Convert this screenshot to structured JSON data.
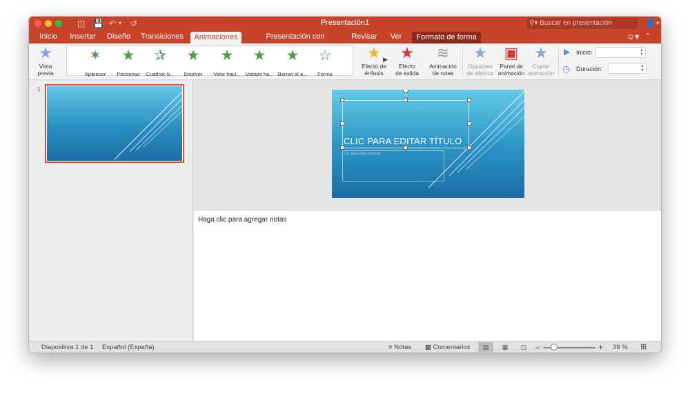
{
  "window": {
    "title": "Presentación1"
  },
  "search": {
    "placeholder": "Buscar en presentación"
  },
  "tabs": [
    {
      "label": "Inicio"
    },
    {
      "label": "Insertar"
    },
    {
      "label": "Diseño"
    },
    {
      "label": "Transiciones"
    },
    {
      "label": "Animaciones"
    },
    {
      "label": "Presentación con diapositivas"
    },
    {
      "label": "Revisar"
    },
    {
      "label": "Ver"
    },
    {
      "label": "Formato de forma"
    }
  ],
  "ribbon": {
    "preview": {
      "line1": "Vista",
      "line2": "previa"
    },
    "gallery": [
      {
        "label": "Aparecer"
      },
      {
        "label": "Persianas"
      },
      {
        "label": "Cuadros b..."
      },
      {
        "label": "Disolver"
      },
      {
        "label": "Volar haci..."
      },
      {
        "label": "Vistazo ha..."
      },
      {
        "label": "Barras al a..."
      },
      {
        "label": "Forma"
      }
    ],
    "emphasis": {
      "line1": "Efecto de",
      "line2": "énfasis"
    },
    "exit": {
      "line1": "Efecto",
      "line2": "de salida"
    },
    "paths": {
      "line1": "Animación",
      "line2": "de rutas"
    },
    "options": {
      "line1": "Opciones",
      "line2": "de efectos"
    },
    "panel": {
      "line1": "Panel de",
      "line2": "animación"
    },
    "copy": {
      "line1": "Copiar",
      "line2": "animación"
    },
    "start_label": "Inicio:",
    "duration_label": "Duración:"
  },
  "thumbnails": [
    {
      "number": "1"
    }
  ],
  "slide": {
    "title_placeholder": "CLIC PARA EDITAR TÍTULO",
    "subtitle_placeholder": "Clic para editar subtítulo"
  },
  "notes": {
    "placeholder": "Haga clic para agregar notas"
  },
  "status": {
    "slide_info": "Diapositiva 1 de 1",
    "language": "Español (España)",
    "notes_label": "Notas",
    "comments_label": "Comentarios",
    "zoom": "39 %"
  },
  "colors": {
    "accent": "#c5442a",
    "active_tab_text": "#c5442a",
    "format_tab": "#8b2a1a"
  },
  "icons": {
    "close": "close-icon",
    "minimize": "minimize-icon",
    "maximize": "maximize-icon",
    "sidebar": "sidebar-icon",
    "save": "save-icon",
    "undo": "undo-icon",
    "redo": "redo-icon",
    "search": "search-icon",
    "share": "add-person-icon",
    "smiley": "smiley-icon",
    "collapse": "chevron-up-icon",
    "star": "star-icon",
    "play": "play-icon",
    "clock": "clock-icon"
  }
}
